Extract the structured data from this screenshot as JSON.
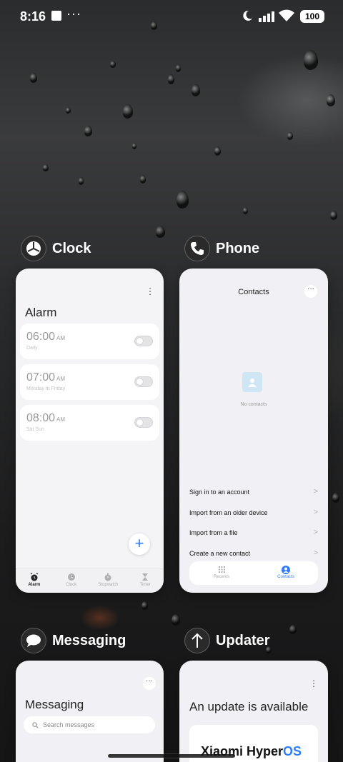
{
  "status_bar": {
    "time": "8:16",
    "overflow": "···",
    "battery": "100"
  },
  "apps": {
    "clock": {
      "name": "Clock",
      "icon": "clock-icon",
      "screen_title": "Alarm",
      "alarms": [
        {
          "time": "06:00",
          "ampm": "AM",
          "repeat": "Daily",
          "enabled": false
        },
        {
          "time": "07:00",
          "ampm": "AM",
          "repeat": "Monday to Friday",
          "enabled": false
        },
        {
          "time": "08:00",
          "ampm": "AM",
          "repeat": "Sat Sun",
          "enabled": false
        }
      ],
      "add_label": "+",
      "tabs": [
        {
          "label": "Alarm",
          "icon": "alarm-icon",
          "active": true
        },
        {
          "label": "Clock",
          "icon": "clock-face-icon",
          "active": false
        },
        {
          "label": "Stopwatch",
          "icon": "stopwatch-icon",
          "active": false
        },
        {
          "label": "Timer",
          "icon": "hourglass-icon",
          "active": false
        }
      ]
    },
    "phone": {
      "name": "Phone",
      "icon": "phone-icon",
      "screen_title": "Contacts",
      "empty_text": "No contacts",
      "options": [
        "Sign in to an account",
        "Import from an older device",
        "Import from a file",
        "Create a new contact"
      ],
      "tabs": [
        {
          "label": "Recents",
          "icon": "keypad-icon",
          "active": false
        },
        {
          "label": "Contacts",
          "icon": "person-icon",
          "active": true
        }
      ]
    },
    "messaging": {
      "name": "Messaging",
      "icon": "chat-bubble-icon",
      "screen_title": "Messaging",
      "search_placeholder": "Search messages"
    },
    "updater": {
      "name": "Updater",
      "icon": "arrow-up-icon",
      "screen_title": "An update is available",
      "brand_prefix": "Xiaomi Hyper",
      "brand_suffix": "OS"
    }
  },
  "colors": {
    "accent": "#2f7cf6",
    "card_bg": "#f1f1f5"
  }
}
